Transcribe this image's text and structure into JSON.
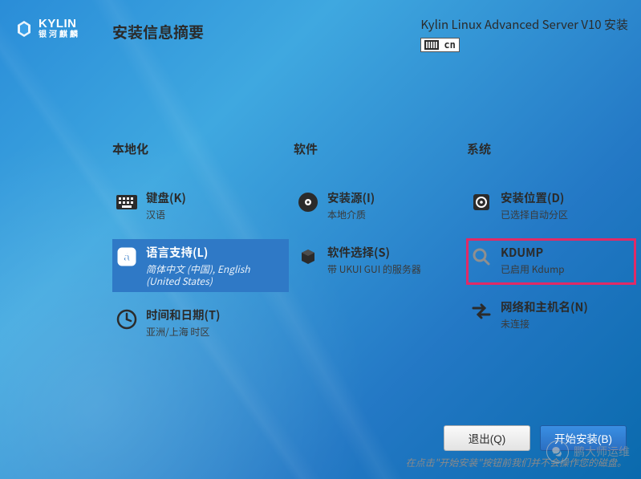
{
  "brand": {
    "en": "KYLIN",
    "cn": "银河麒麟"
  },
  "page_title": "安装信息摘要",
  "header": {
    "product": "Kylin Linux Advanced Server V10 安装",
    "keyboard_indicator": "cn"
  },
  "columns": {
    "localization": {
      "heading": "本地化",
      "spokes": [
        {
          "id": "keyboard",
          "title": "键盘(K)",
          "sub": "汉语"
        },
        {
          "id": "language",
          "title": "语言支持(L)",
          "sub": "简体中文 (中国), English (United States)",
          "selected": true
        },
        {
          "id": "datetime",
          "title": "时间和日期(T)",
          "sub": "亚洲/上海 时区"
        }
      ]
    },
    "software": {
      "heading": "软件",
      "spokes": [
        {
          "id": "source",
          "title": "安装源(I)",
          "sub": "本地介质"
        },
        {
          "id": "selection",
          "title": "软件选择(S)",
          "sub": "带 UKUI GUI 的服务器"
        }
      ]
    },
    "system": {
      "heading": "系统",
      "spokes": [
        {
          "id": "destination",
          "title": "安装位置(D)",
          "sub": "已选择自动分区"
        },
        {
          "id": "kdump",
          "title": "KDUMP",
          "sub": "已启用 Kdump",
          "highlighted": true
        },
        {
          "id": "network",
          "title": "网络和主机名(N)",
          "sub": "未连接"
        }
      ]
    }
  },
  "footer": {
    "quit": "退出(Q)",
    "begin": "开始安装(B)",
    "hint": "在点击\"开始安装\"按钮前我们并不会操作您的磁盘。"
  },
  "watermark": "鹏大师运维"
}
